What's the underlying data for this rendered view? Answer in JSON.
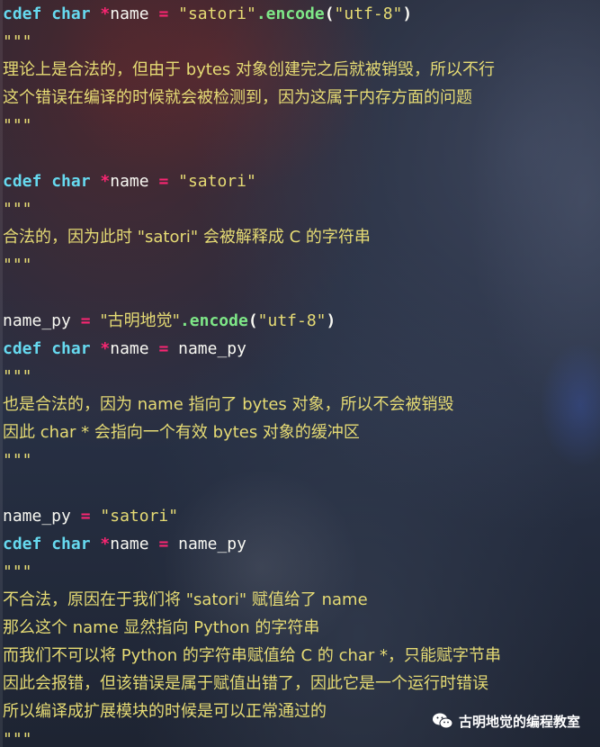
{
  "code_lines": [
    {
      "tokens": [
        {
          "t": "cdef",
          "c": "kw"
        },
        {
          "t": " ",
          "c": "id"
        },
        {
          "t": "char",
          "c": "kw"
        },
        {
          "t": " ",
          "c": "id"
        },
        {
          "t": "*",
          "c": "op"
        },
        {
          "t": "name ",
          "c": "id"
        },
        {
          "t": "=",
          "c": "op"
        },
        {
          "t": " ",
          "c": "id"
        },
        {
          "t": "\"satori\"",
          "c": "str"
        },
        {
          "t": ".encode",
          "c": "fn"
        },
        {
          "t": "(",
          "c": "paren"
        },
        {
          "t": "\"utf-8\"",
          "c": "str"
        },
        {
          "t": ")",
          "c": "paren"
        }
      ]
    },
    {
      "tokens": [
        {
          "t": "\"\"\"",
          "c": "doc"
        }
      ]
    },
    {
      "tokens": [
        {
          "t": "理论上是合法的，但由于 bytes 对象创建完之后就被销毁，所以不行",
          "c": "doc"
        }
      ]
    },
    {
      "tokens": [
        {
          "t": "这个错误在编译的时候就会被检测到，因为这属于内存方面的问题",
          "c": "doc"
        }
      ]
    },
    {
      "tokens": [
        {
          "t": "\"\"\"",
          "c": "doc"
        }
      ]
    },
    {
      "tokens": []
    },
    {
      "tokens": [
        {
          "t": "cdef",
          "c": "kw"
        },
        {
          "t": " ",
          "c": "id"
        },
        {
          "t": "char",
          "c": "kw"
        },
        {
          "t": " ",
          "c": "id"
        },
        {
          "t": "*",
          "c": "op"
        },
        {
          "t": "name ",
          "c": "id"
        },
        {
          "t": "=",
          "c": "op"
        },
        {
          "t": " ",
          "c": "id"
        },
        {
          "t": "\"satori\"",
          "c": "str"
        }
      ]
    },
    {
      "tokens": [
        {
          "t": "\"\"\"",
          "c": "doc"
        }
      ]
    },
    {
      "tokens": [
        {
          "t": "合法的，因为此时 \"satori\" 会被解释成 C 的字符串",
          "c": "doc"
        }
      ]
    },
    {
      "tokens": [
        {
          "t": "\"\"\"",
          "c": "doc"
        }
      ]
    },
    {
      "tokens": []
    },
    {
      "tokens": [
        {
          "t": "name_py ",
          "c": "id"
        },
        {
          "t": "=",
          "c": "op"
        },
        {
          "t": " ",
          "c": "id"
        },
        {
          "t": "\"古明地觉\"",
          "c": "str"
        },
        {
          "t": ".encode",
          "c": "fn"
        },
        {
          "t": "(",
          "c": "paren"
        },
        {
          "t": "\"utf-8\"",
          "c": "str"
        },
        {
          "t": ")",
          "c": "paren"
        }
      ]
    },
    {
      "tokens": [
        {
          "t": "cdef",
          "c": "kw"
        },
        {
          "t": " ",
          "c": "id"
        },
        {
          "t": "char",
          "c": "kw"
        },
        {
          "t": " ",
          "c": "id"
        },
        {
          "t": "*",
          "c": "op"
        },
        {
          "t": "name ",
          "c": "id"
        },
        {
          "t": "=",
          "c": "op"
        },
        {
          "t": " name_py",
          "c": "id"
        }
      ]
    },
    {
      "tokens": [
        {
          "t": "\"\"\"",
          "c": "doc"
        }
      ]
    },
    {
      "tokens": [
        {
          "t": "也是合法的，因为 name 指向了 bytes 对象，所以不会被销毁",
          "c": "doc"
        }
      ]
    },
    {
      "tokens": [
        {
          "t": "因此 char * 会指向一个有效 bytes 对象的缓冲区",
          "c": "doc"
        }
      ]
    },
    {
      "tokens": [
        {
          "t": "\"\"\"",
          "c": "doc"
        }
      ]
    },
    {
      "tokens": []
    },
    {
      "tokens": [
        {
          "t": "name_py ",
          "c": "id"
        },
        {
          "t": "=",
          "c": "op"
        },
        {
          "t": " ",
          "c": "id"
        },
        {
          "t": "\"satori\"",
          "c": "str"
        }
      ]
    },
    {
      "tokens": [
        {
          "t": "cdef",
          "c": "kw"
        },
        {
          "t": " ",
          "c": "id"
        },
        {
          "t": "char",
          "c": "kw"
        },
        {
          "t": " ",
          "c": "id"
        },
        {
          "t": "*",
          "c": "op"
        },
        {
          "t": "name ",
          "c": "id"
        },
        {
          "t": "=",
          "c": "op"
        },
        {
          "t": " name_py",
          "c": "id"
        }
      ]
    },
    {
      "tokens": [
        {
          "t": "\"\"\"",
          "c": "doc"
        }
      ]
    },
    {
      "tokens": [
        {
          "t": "不合法，原因在于我们将 \"satori\" 赋值给了 name",
          "c": "doc"
        }
      ]
    },
    {
      "tokens": [
        {
          "t": "那么这个 name 显然指向 Python 的字符串",
          "c": "doc"
        }
      ]
    },
    {
      "tokens": [
        {
          "t": "而我们不可以将 Python 的字符串赋值给 C 的 char *，只能赋字节串",
          "c": "doc"
        }
      ]
    },
    {
      "tokens": [
        {
          "t": "因此会报错，但该错误是属于赋值出错了，因此它是一个运行时错误",
          "c": "doc"
        }
      ]
    },
    {
      "tokens": [
        {
          "t": "所以编译成扩展模块的时候是可以正常通过的",
          "c": "doc"
        }
      ]
    },
    {
      "tokens": [
        {
          "t": "\"\"\"",
          "c": "doc"
        }
      ]
    }
  ],
  "watermark": {
    "icon": "wechat-icon",
    "text": "古明地觉的编程教室"
  },
  "colors": {
    "keyword": "#66d9ef",
    "operator": "#f92672",
    "string": "#e6db74",
    "method": "#7ee787",
    "text": "#f8f8f2"
  }
}
